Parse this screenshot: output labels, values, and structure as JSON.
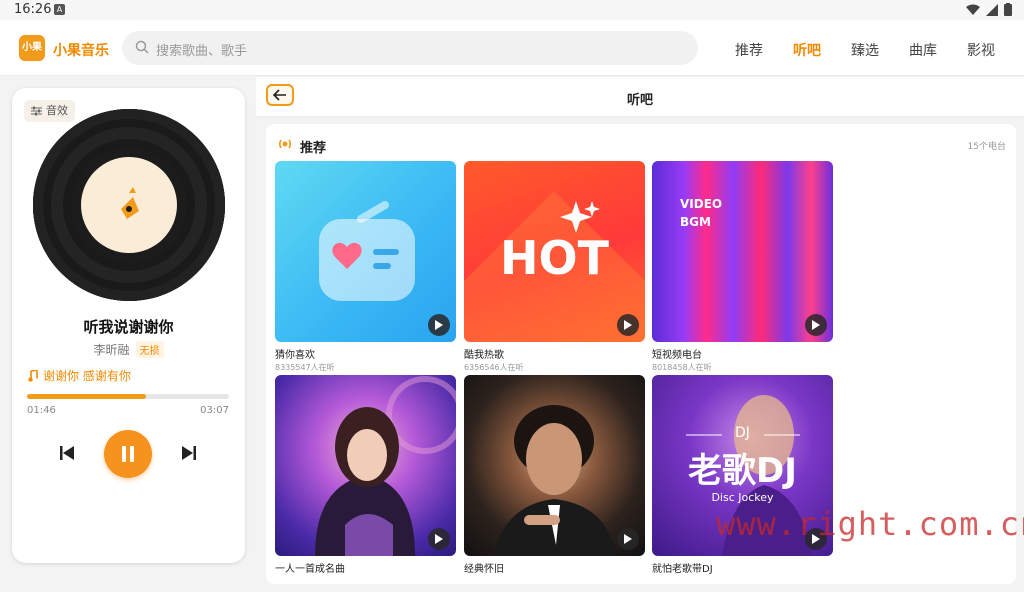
{
  "status": {
    "time": "16:26",
    "notif": "A"
  },
  "app": {
    "logo_text": "小果",
    "name": "小果音乐"
  },
  "search": {
    "placeholder": "搜索歌曲、歌手"
  },
  "nav": {
    "tabs": [
      "推荐",
      "听吧",
      "臻选",
      "曲库",
      "影视"
    ],
    "active_index": 1
  },
  "player": {
    "effects_label": "音效",
    "song_title": "听我说谢谢你",
    "artist": "李昕融",
    "quality_badge": "无损",
    "lyric": "谢谢你 感谢有你",
    "current_time": "01:46",
    "duration": "03:07",
    "progress": 0.59
  },
  "main": {
    "title": "听吧",
    "section_title": "推荐",
    "section_count": "15个电台",
    "cards": [
      {
        "name": "猜你喜欢",
        "listeners": "8335547人在听",
        "cover_icon": "heart-radio-icon"
      },
      {
        "name": "酷我热歌",
        "listeners": "6356546人在听",
        "cover_text": "HOT"
      },
      {
        "name": "短视频电台",
        "listeners": "8018458人在听",
        "cover_text_1": "VIDEO",
        "cover_text_2": "BGM"
      },
      {
        "name": "一人一首成名曲",
        "listeners": ""
      },
      {
        "name": "经典怀旧",
        "listeners": ""
      },
      {
        "name": "就怕老歌带DJ",
        "listeners": "",
        "cover_text_dj": "DJ",
        "cover_text": "老歌DJ",
        "cover_sub": "Disc Jockey"
      }
    ]
  },
  "watermark": "www.right.com.cn",
  "colors": {
    "accent": "#f08a00",
    "accent_fill": "#f29b1b"
  }
}
